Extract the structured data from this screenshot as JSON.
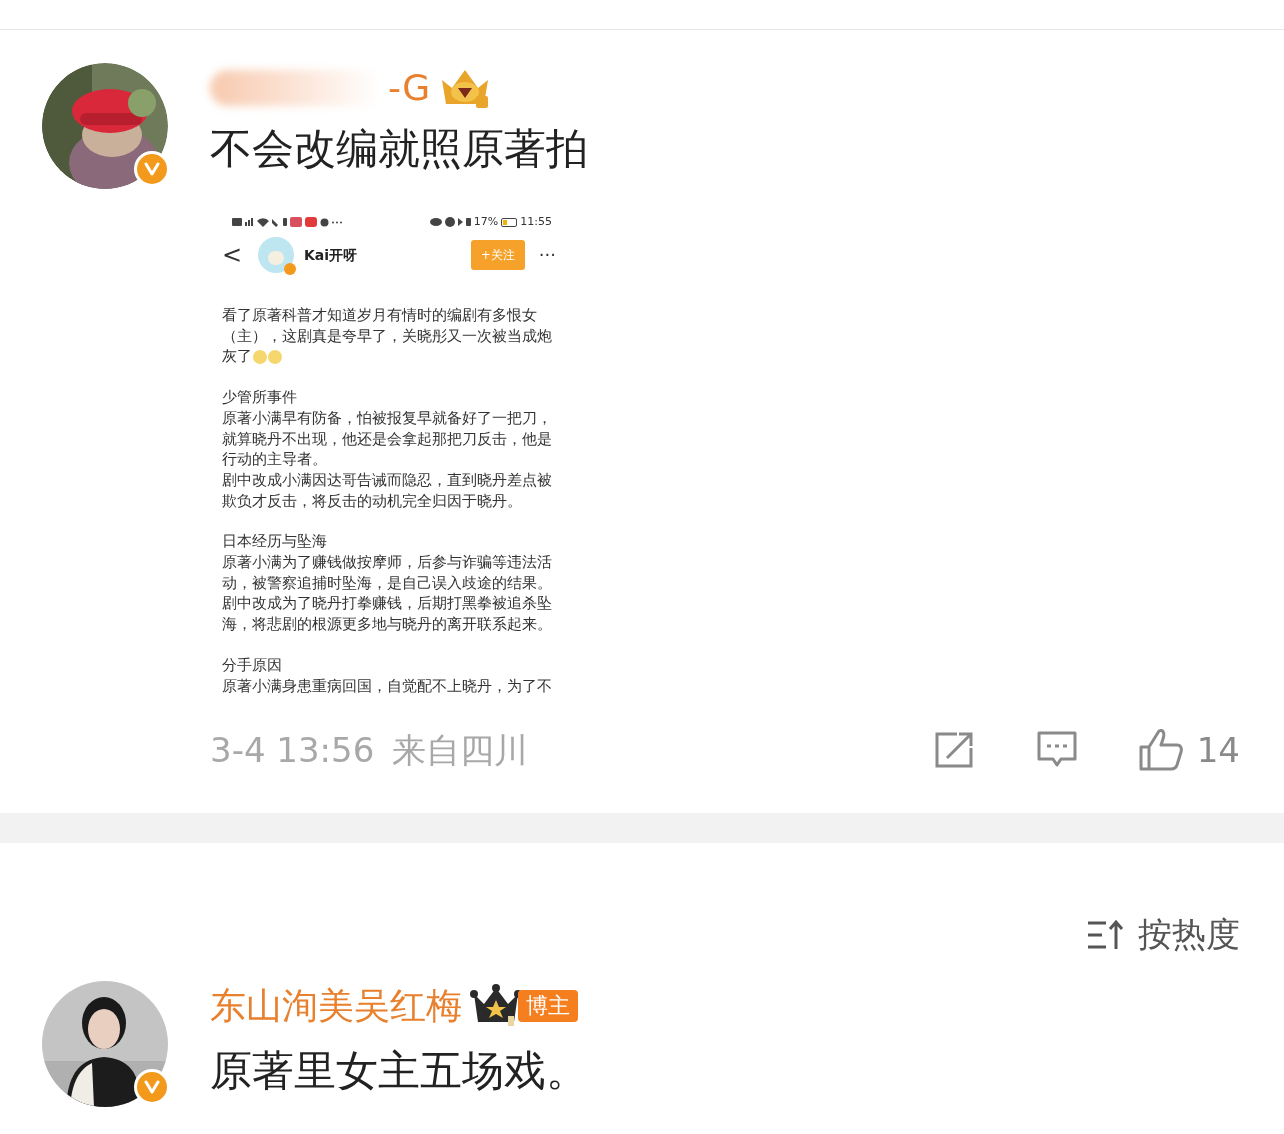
{
  "posts": [
    {
      "author": {
        "name": "-G",
        "name_redacted": true,
        "kind": "gold"
      },
      "verified": true,
      "text": "不会改编就照原著拍",
      "attachment": {
        "kind": "screenshot",
        "status_bar": {
          "battery": "17%",
          "time": "11:55"
        },
        "header": {
          "back": "<",
          "name": "Kai开呀",
          "follow": "+关注",
          "more": "···"
        },
        "sections": [
          [
            {
              "kind": "text",
              "text": "看了原著科普才知道岁月有情时的编剧有多恨女（主），这剧真是夸早了，关晓彤又一次被当成炮"
            },
            {
              "kind": "text-with-emoji",
              "text": "灰了"
            }
          ],
          [
            {
              "kind": "text",
              "text": "少管所事件"
            },
            {
              "kind": "text",
              "text": "原著小满早有防备，怕被报复早就备好了一把刀，就算晓丹不出现，他还是会拿起那把刀反击，他是行动的主导者。"
            },
            {
              "kind": "text",
              "text": "剧中改成小满因达哥告诫而隐忍，直到晓丹差点被欺负才反击，将反击的动机完全归因于晓丹。"
            }
          ],
          [
            {
              "kind": "text",
              "text": "日本经历与坠海"
            },
            {
              "kind": "text",
              "text": "原著小满为了赚钱做按摩师，后参与诈骗等违法活动，被警察追捕时坠海，是自己误入歧途的结果。"
            },
            {
              "kind": "text",
              "text": "剧中改成为了晓丹打拳赚钱，后期打黑拳被追杀坠海，将悲剧的根源更多地与晓丹的离开联系起来。"
            }
          ],
          [
            {
              "kind": "text",
              "text": "分手原因"
            },
            {
              "kind": "text",
              "text": "原著小满身患重病回国，自觉配不上晓丹，为了不"
            }
          ]
        ]
      },
      "time": "3-4 13:56",
      "source": "来自四川",
      "likes": "14"
    }
  ],
  "sort": {
    "label": "按热度"
  },
  "comments": [
    {
      "author": {
        "name": "东山洵美吴红梅",
        "name_redacted": false,
        "kind": "dark",
        "tag": "博主"
      },
      "verified": true,
      "text": "原著里女主五场戏。"
    }
  ]
}
